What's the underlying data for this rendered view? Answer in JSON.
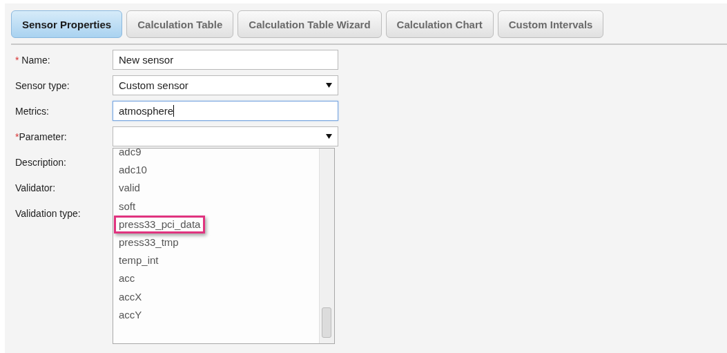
{
  "tabs": [
    {
      "label": "Sensor Properties",
      "selected": true
    },
    {
      "label": "Calculation Table",
      "selected": false
    },
    {
      "label": "Calculation Table Wizard",
      "selected": false
    },
    {
      "label": "Calculation Chart",
      "selected": false
    },
    {
      "label": "Custom Intervals",
      "selected": false
    }
  ],
  "fields": [
    {
      "label": "Name:",
      "required_mark": "* ",
      "kind": "text",
      "value": "New sensor",
      "focused": false
    },
    {
      "label": "Sensor type:",
      "kind": "select",
      "value": "Custom sensor"
    },
    {
      "label": "Metrics:",
      "kind": "text",
      "value": "atmosphere",
      "focused": true
    },
    {
      "label": "Parameter:",
      "required_mark": "*",
      "kind": "select",
      "options": [
        {
          "label": "adc9",
          "highlighted": false
        },
        {
          "label": "adc10",
          "highlighted": false
        },
        {
          "label": "valid",
          "highlighted": false
        },
        {
          "label": "soft",
          "highlighted": false
        },
        {
          "label": "press33_pci_data",
          "highlighted": true
        },
        {
          "label": "press33_tmp",
          "highlighted": false
        },
        {
          "label": "temp_int",
          "highlighted": false
        },
        {
          "label": "acc",
          "highlighted": false
        },
        {
          "label": "accX",
          "highlighted": false
        },
        {
          "label": "accY",
          "highlighted": false
        }
      ]
    },
    {
      "label": "Description:",
      "kind": "label"
    },
    {
      "label": "Validator:",
      "kind": "label"
    },
    {
      "label": "Validation type:",
      "kind": "label"
    }
  ]
}
